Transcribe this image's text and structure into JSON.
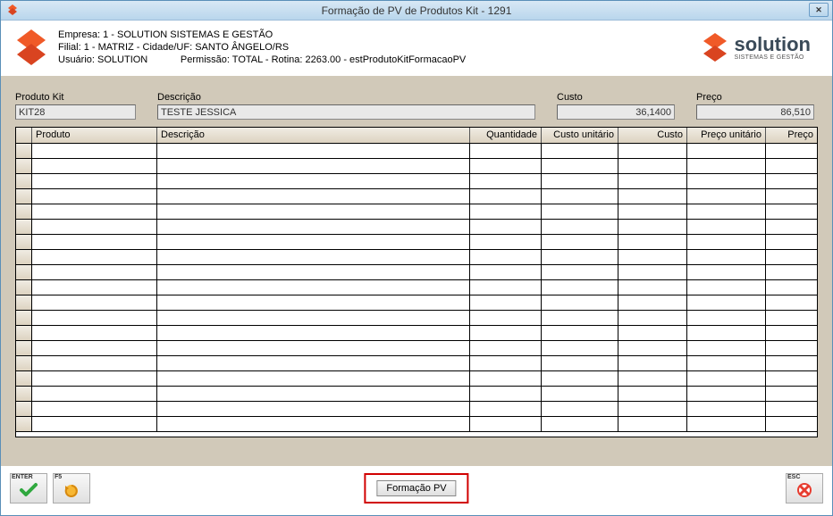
{
  "window": {
    "title": "Formação de PV de Produtos Kit - 1291"
  },
  "header": {
    "empresa": "Empresa: 1 - SOLUTION SISTEMAS E GESTÃO",
    "filial": "Filial: 1 - MATRIZ - Cidade/UF: SANTO ÂNGELO/RS",
    "usuario_line": "Usuário: SOLUTION            Permissão: TOTAL - Rotina: 2263.00 - estProdutoKitFormacaoPV",
    "brand": "solution",
    "brand_sub": "SISTEMAS E GESTÃO"
  },
  "form": {
    "produto_kit_label": "Produto Kit",
    "produto_kit_value": "KIT28",
    "descricao_label": "Descrição",
    "descricao_value": "TESTE JESSICA",
    "custo_label": "Custo",
    "custo_value": "36,1400",
    "preco_label": "Preço",
    "preco_value": "86,510"
  },
  "grid": {
    "columns": {
      "produto": "Produto",
      "descricao": "Descrição",
      "quantidade": "Quantidade",
      "custo_unitario": "Custo unitário",
      "custo": "Custo",
      "preco_unitario": "Preço unitário",
      "preco": "Preço"
    }
  },
  "footer": {
    "enter_label": "ENTER",
    "f5_label": "F5",
    "formacao_label": "Formação PV",
    "esc_label": "ESC"
  },
  "icons": {
    "close": "✕"
  }
}
